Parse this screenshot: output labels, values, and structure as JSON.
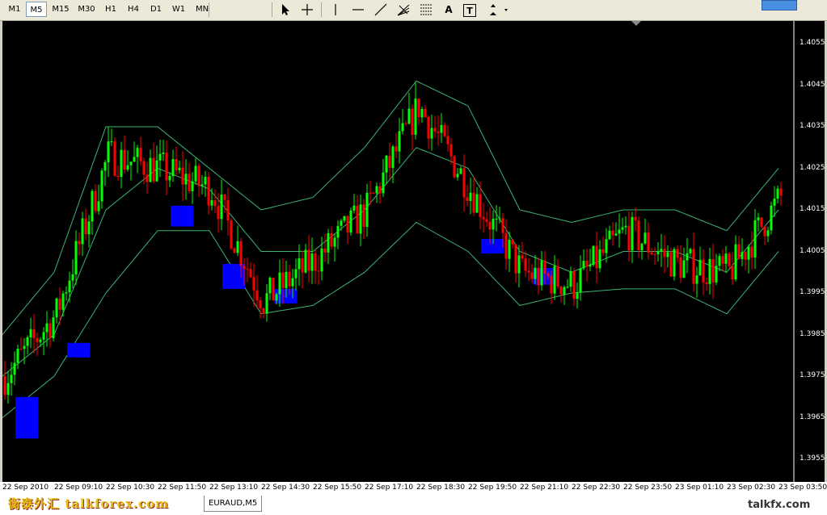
{
  "toolbar": {
    "timeframes": [
      "M1",
      "M5",
      "M15",
      "M30",
      "H1",
      "H4",
      "D1",
      "W1",
      "MN"
    ],
    "selected": "M5",
    "tools": [
      "cursor-icon",
      "crosshair-icon",
      "vertical-line-icon",
      "horizontal-line-icon",
      "trendline-icon",
      "fibonacci-fan-icon",
      "fibonacci-retracement-icon",
      "text-icon",
      "text-label-icon",
      "arrows-icon"
    ],
    "tool_labels": {
      "text": "A",
      "text_label": "T"
    }
  },
  "chart": {
    "symbol": "EURAUD,M5",
    "ylabels": [
      "1.4055",
      "1.4045",
      "1.4035",
      "1.4025",
      "1.4015",
      "1.4005",
      "1.3995",
      "1.3985",
      "1.3975",
      "1.3965",
      "1.3955"
    ],
    "xlabels": [
      "22 Sep 2010",
      "22 Sep 09:10",
      "22 Sep 10:30",
      "22 Sep 11:50",
      "22 Sep 13:10",
      "22 Sep 14:30",
      "22 Sep 15:50",
      "22 Sep 17:10",
      "22 Sep 18:30",
      "22 Sep 19:50",
      "22 Sep 21:10",
      "22 Sep 22:30",
      "22 Sep 23:50",
      "23 Sep 01:10",
      "23 Sep 02:30",
      "23 Sep 03:50"
    ],
    "colors": {
      "up": "#00ff00",
      "down": "#ff0000",
      "band": "#3cb371",
      "box": "#0000ff",
      "bg": "#000000"
    }
  },
  "chart_data": {
    "type": "candlestick",
    "symbol": "EURAUD",
    "timeframe": "M5",
    "ylim": [
      1.395,
      1.406
    ],
    "x": [
      "22 Sep 2010",
      "22 Sep 09:10",
      "22 Sep 10:30",
      "22 Sep 11:50",
      "22 Sep 13:10",
      "22 Sep 14:30",
      "22 Sep 15:50",
      "22 Sep 17:10",
      "22 Sep 18:30",
      "22 Sep 19:50",
      "22 Sep 21:10",
      "22 Sep 22:30",
      "22 Sep 23:50",
      "23 Sep 01:10",
      "23 Sep 02:30",
      "23 Sep 03:50"
    ],
    "close": [
      1.3975,
      1.399,
      1.4028,
      1.4025,
      1.402,
      1.3993,
      1.4003,
      1.4015,
      1.404,
      1.402,
      1.4,
      1.3997,
      1.401,
      1.4002,
      1.4,
      1.4018
    ],
    "bollinger_upper": [
      1.3985,
      1.4,
      1.4035,
      1.4035,
      1.4025,
      1.4015,
      1.4018,
      1.403,
      1.4046,
      1.404,
      1.4015,
      1.4012,
      1.4015,
      1.4015,
      1.401,
      1.4025
    ],
    "bollinger_middle": [
      1.3975,
      1.3985,
      1.4015,
      1.4025,
      1.402,
      1.4005,
      1.4005,
      1.4015,
      1.403,
      1.4025,
      1.4005,
      1.4,
      1.4005,
      1.4005,
      1.4,
      1.4015
    ],
    "bollinger_lower": [
      1.3965,
      1.3975,
      1.3995,
      1.401,
      1.401,
      1.399,
      1.3992,
      1.4,
      1.4012,
      1.4005,
      1.3992,
      1.3995,
      1.3996,
      1.3996,
      1.399,
      1.4005
    ],
    "highlight_boxes": [
      {
        "time": "22 Sep 2010",
        "low": 1.396,
        "high": 1.397
      },
      {
        "time": "22 Sep 09:10",
        "low": 1.398,
        "high": 1.3983
      },
      {
        "time": "22 Sep 11:50",
        "low": 1.4011,
        "high": 1.4016
      },
      {
        "time": "22 Sep 13:10",
        "low": 1.3996,
        "high": 1.4002
      },
      {
        "time": "22 Sep 14:30",
        "low": 1.3993,
        "high": 1.3996
      },
      {
        "time": "22 Sep 19:50",
        "low": 1.4005,
        "high": 1.4008
      },
      {
        "time": "22 Sep 21:10",
        "low": 1.3997,
        "high": 1.4001
      }
    ]
  },
  "tabs": {
    "active": "EURAUD,M5"
  },
  "watermarks": {
    "left": "衡泰外汇 talkforex.com",
    "right": "talkfx.com"
  }
}
